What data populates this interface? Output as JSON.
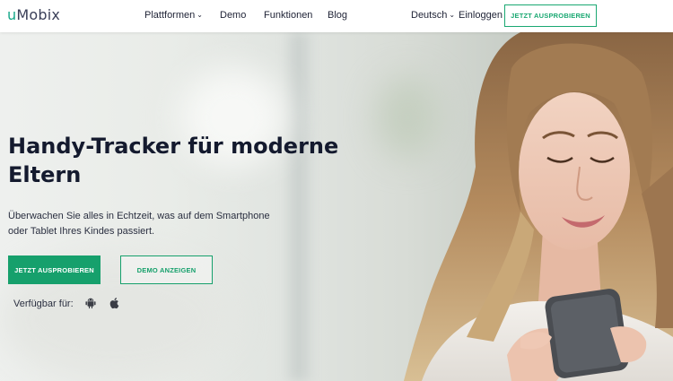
{
  "header": {
    "logo_u": "u",
    "logo_rest": "Mobix",
    "nav": {
      "platforms": "Plattformen",
      "demo": "Demo",
      "features": "Funktionen",
      "blog": "Blog"
    },
    "language": "Deutsch",
    "login": "Einloggen",
    "cta": "JETZT AUSPROBIEREN"
  },
  "hero": {
    "headline_line1": "Handy-Tracker für moderne",
    "headline_line2": "Eltern",
    "subtext_line1": "Überwachen Sie alles in Echtzeit, was auf dem Smartphone",
    "subtext_line2": "oder Tablet Ihres Kindes passiert.",
    "primary_button": "JETZT AUSPROBIEREN",
    "secondary_button": "DEMO ANZEIGEN",
    "available_label": "Verfügbar für:",
    "icons": [
      "android-icon",
      "apple-icon"
    ]
  },
  "colors": {
    "brand_green": "#16a06c",
    "logo_teal": "#17a88a",
    "heading": "#141a2e"
  }
}
